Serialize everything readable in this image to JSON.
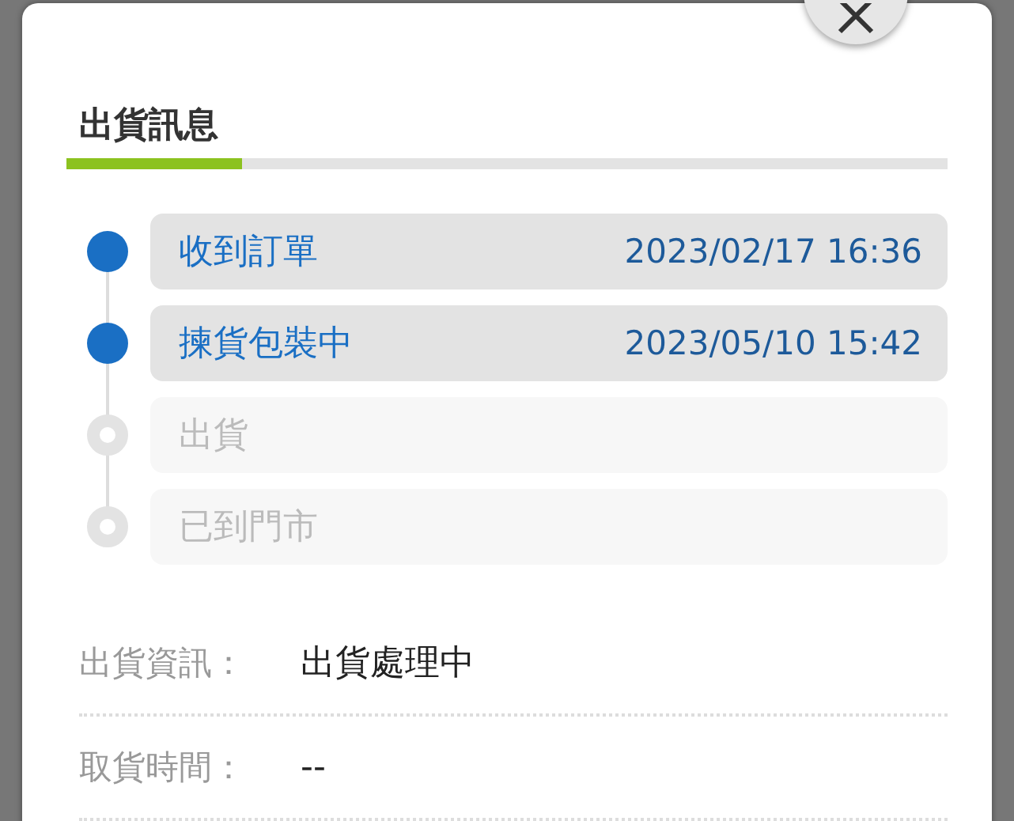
{
  "section": {
    "title": "出貨訊息",
    "level": 0.2
  },
  "steps": [
    {
      "label": "收到訂單",
      "time": "2023/02/17 16:36",
      "done": true
    },
    {
      "label": "揀貨包裝中",
      "time": "2023/05/10 15:42",
      "done": true
    },
    {
      "label": "出貨",
      "done": false
    },
    {
      "label": "已到門市",
      "done": false
    }
  ],
  "info": [
    {
      "label": "出貨資訊：",
      "value": "出貨處理中"
    },
    {
      "label": "取貨時間：",
      "value": "--"
    }
  ]
}
